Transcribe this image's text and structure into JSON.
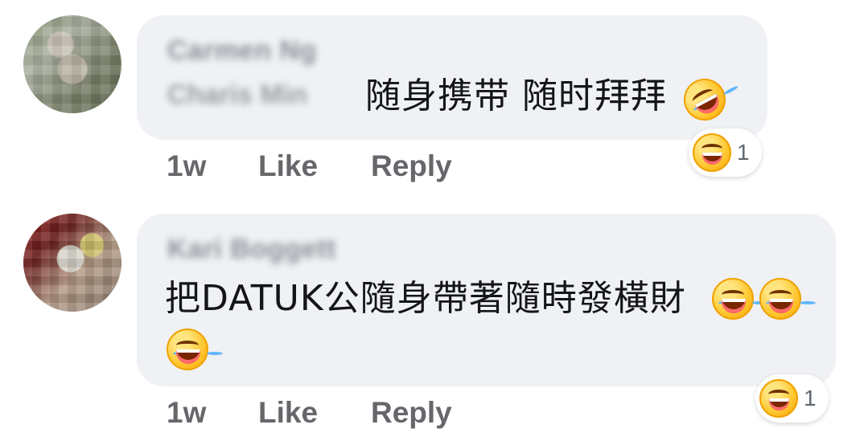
{
  "comments": [
    {
      "author": "Carmen Ng",
      "mention": "Charis Min",
      "text": "随身携带 随时拜拜",
      "meta": {
        "time": "1w",
        "like": "Like",
        "reply": "Reply"
      },
      "reactions": {
        "count": "1",
        "icon": "laughing-face-icon"
      }
    },
    {
      "author": "Kari Boggett",
      "text": "把DATUK公隨身帶著隨時發橫財",
      "meta": {
        "time": "1w",
        "like": "Like",
        "reply": "Reply"
      },
      "reactions": {
        "count": "1",
        "icon": "laughing-face-icon"
      }
    }
  ],
  "icons": {
    "inline_1": "rolling-laughing-icon",
    "inline_2": "tears-of-joy-icon"
  }
}
